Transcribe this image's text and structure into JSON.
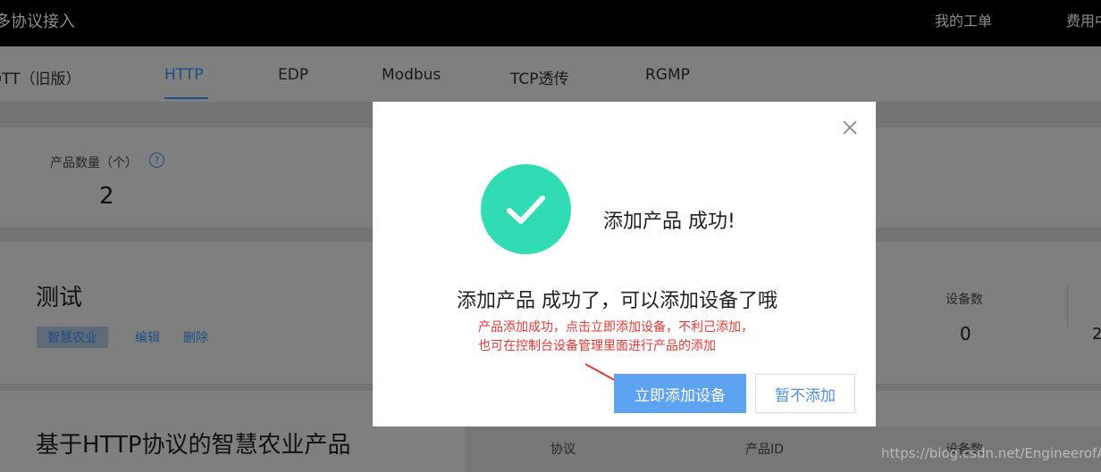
{
  "topbar": {
    "title": "多协议接入",
    "nav": [
      "我的工单",
      "费用中心"
    ]
  },
  "tabs": [
    "MQTT（旧版）",
    "HTTP",
    "EDP",
    "Modbus",
    "TCP透传",
    "RGMP"
  ],
  "active_tab": "HTTP",
  "stats": {
    "label": "产品数量（个）",
    "help_icon": "question-circle-icon",
    "value": "2"
  },
  "products": [
    {
      "name": "测试",
      "tag": "智慧农业",
      "actions": [
        "编辑",
        "删除"
      ],
      "device_count_label": "设备数",
      "device_count": "0",
      "extra_value": "2"
    },
    {
      "name": "基于HTTP协议的智慧农业产品",
      "columns": [
        "协议",
        "产品ID",
        "设备数"
      ]
    }
  ],
  "watermark": "https://blog.csdn.net/EngineerofAI",
  "modal": {
    "close_icon": "close-icon",
    "success_icon": "check-circle-icon",
    "success_title": "添加产品 成功!",
    "message": "添加产品 成功了，可以添加设备了哦",
    "note_line1": "产品添加成功，点击立即添加设备，不利己添加，",
    "note_line2": "也可在控制台设备管理里面进行产品的添加",
    "primary_button": "立即添加设备",
    "secondary_button": "暂不添加"
  },
  "colors": {
    "primary": "#5ea2f2",
    "success": "#2fdcb4",
    "note": "#e53935"
  }
}
